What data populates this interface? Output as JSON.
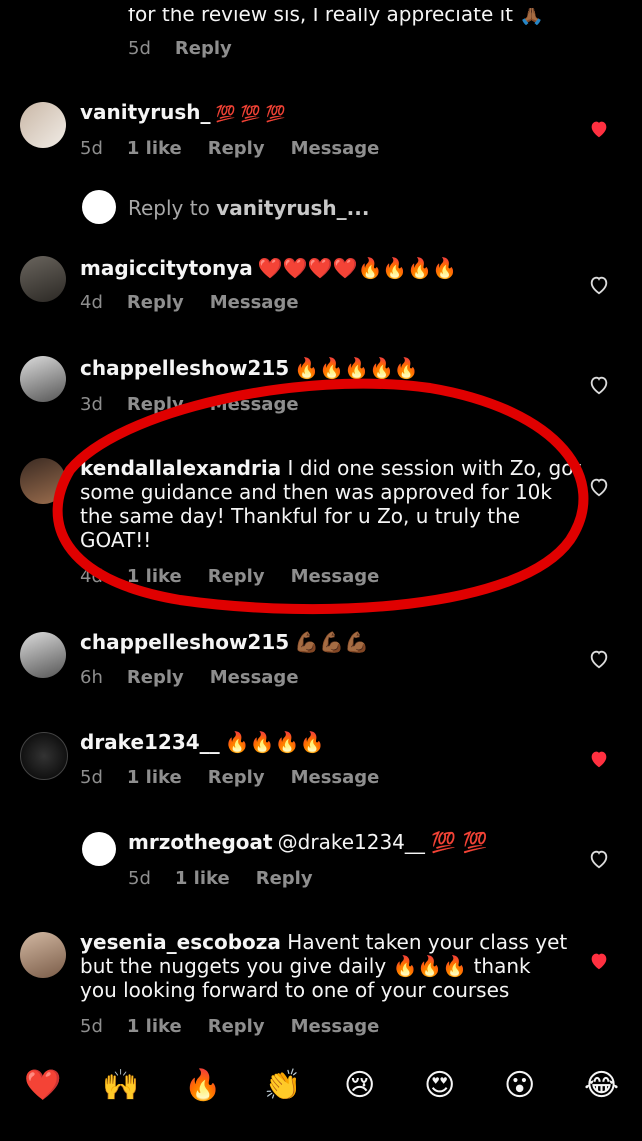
{
  "comments": [
    {
      "text": "for the review sis, I really appreciate it 🙏🏾",
      "time": "5d",
      "reply": "Reply"
    },
    {
      "user": "vanityrush_",
      "text": "💯 💯 💯",
      "time": "5d",
      "likes": "1 like",
      "reply": "Reply",
      "message": "Message",
      "liked": true
    },
    {
      "reply_prompt": "Reply to",
      "reply_user": "vanityrush_..."
    },
    {
      "user": "magiccitytonya",
      "text": "❤️❤️❤️❤️🔥🔥🔥🔥",
      "time": "4d",
      "reply": "Reply",
      "message": "Message",
      "liked": false
    },
    {
      "user": "chappelleshow215",
      "text": "🔥🔥🔥🔥🔥",
      "time": "3d",
      "reply": "Reply",
      "message": "Message",
      "liked": false
    },
    {
      "user": "kendallalexandria",
      "text": "I did one session with Zo, got some guidance and then was approved for 10k the same day! Thankful for u Zo, u truly the GOAT!!",
      "line1": "I did one session with Zo, got",
      "line2": "some guidance and then was approved for 10k",
      "line3": "the same day! Thankful for u Zo, u truly the",
      "line4": "GOAT!!",
      "time": "4d",
      "likes": "1 like",
      "reply": "Reply",
      "message": "Message",
      "liked": false
    },
    {
      "user": "chappelleshow215",
      "text": "💪🏾💪🏾💪🏾",
      "time": "6h",
      "reply": "Reply",
      "message": "Message",
      "liked": false
    },
    {
      "user": "drake1234__",
      "text": "🔥🔥🔥🔥",
      "time": "5d",
      "likes": "1 like",
      "reply": "Reply",
      "message": "Message",
      "liked": true
    },
    {
      "user": "mrzothegoat",
      "text": "@drake1234__ 💯 💯",
      "time": "5d",
      "likes": "1 like",
      "reply": "Reply",
      "liked": false
    },
    {
      "user": "yesenia_escoboza",
      "line1": "Havent taken your class yet",
      "line2": "but the nuggets you give daily 🔥🔥🔥 thank",
      "line3": "you looking forward to one of your courses",
      "time": "5d",
      "likes": "1 like",
      "reply": "Reply",
      "message": "Message",
      "liked": true
    }
  ],
  "emoji_bar": [
    "❤️",
    "🙌",
    "🔥",
    "👏",
    "😢",
    "😍",
    "😮",
    "😂"
  ],
  "colors": {
    "like_red": "#ff3040",
    "meta_gray": "#8e8e8e",
    "annotation_red": "#e00000"
  }
}
